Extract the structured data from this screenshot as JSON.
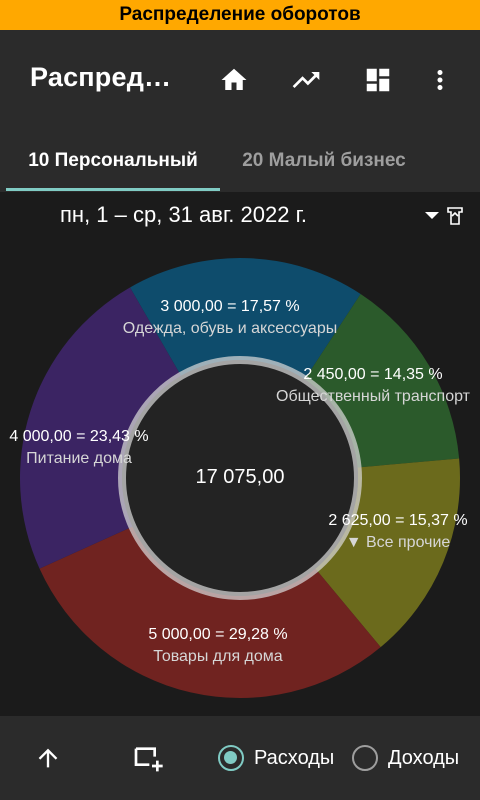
{
  "banner": {
    "title": "Распределение оборотов"
  },
  "appbar": {
    "title": "Распред…",
    "icons": [
      "home-icon",
      "trending-up-icon",
      "dashboard-icon",
      "more-vert-icon"
    ]
  },
  "tabs": [
    {
      "label": "10 Персональный",
      "active": true
    },
    {
      "label": "20 Малый бизнес",
      "active": false
    }
  ],
  "date_range": "пн, 1 – ср, 31 авг. 2022 г.",
  "chart_data": {
    "type": "pie",
    "total": "17 075,00",
    "slices": [
      {
        "name": "Одежда, обувь и аксессуары",
        "value": 3000.0,
        "value_label": "3 000,00",
        "percent": 17.57,
        "percent_label": "17,57 %",
        "color": "#0e4c6c"
      },
      {
        "name": "Общественный транспорт",
        "value": 2450.0,
        "value_label": "2 450,00",
        "percent": 14.35,
        "percent_label": "14,35 %",
        "color": "#2b5a2b"
      },
      {
        "name": "▼ Все прочие",
        "value": 2625.0,
        "value_label": "2 625,00",
        "percent": 15.37,
        "percent_label": "15,37 %",
        "color": "#6b6a1c"
      },
      {
        "name": "Товары для дома",
        "value": 5000.0,
        "value_label": "5 000,00",
        "percent": 29.28,
        "percent_label": "29,28 %",
        "color": "#702320"
      },
      {
        "name": "Питание дома",
        "value": 4000.0,
        "value_label": "4 000,00",
        "percent": 23.43,
        "percent_label": "23,43 %",
        "color": "#3b2463"
      }
    ]
  },
  "bottombar": {
    "icons": [
      "arrow-up-icon",
      "add-window-icon"
    ],
    "radio_expenses": {
      "label": "Расходы",
      "checked": true
    },
    "radio_income": {
      "label": "Доходы",
      "checked": false
    }
  },
  "colors": {
    "accent": "#80cbc4",
    "banner": "#ffa800"
  }
}
